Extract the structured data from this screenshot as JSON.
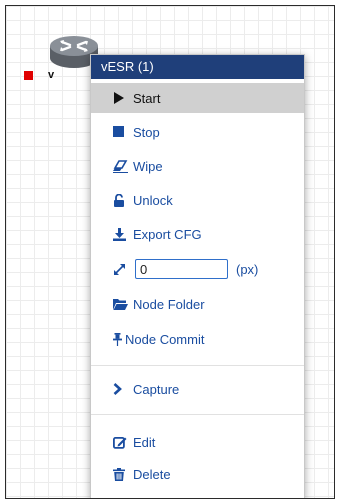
{
  "node": {
    "label_fragment": "v",
    "icon": "router-icon",
    "status_color": "#e00000"
  },
  "menu": {
    "title": "vESR (1)",
    "header_color": "#1f3f7a",
    "items": {
      "start": {
        "label": "Start",
        "icon": "play-icon"
      },
      "stop": {
        "label": "Stop",
        "icon": "stop-icon"
      },
      "wipe": {
        "label": "Wipe",
        "icon": "eraser-icon"
      },
      "unlock": {
        "label": "Unlock",
        "icon": "unlock-icon"
      },
      "export_cfg": {
        "label": "Export CFG",
        "icon": "download-icon"
      },
      "resize": {
        "value": "0",
        "unit": "(px)",
        "icon": "resize-icon"
      },
      "node_folder": {
        "label": "Node Folder",
        "icon": "folder-icon"
      },
      "node_commit": {
        "label": "Node Commit",
        "icon": "pin-icon"
      },
      "capture": {
        "label": "Capture",
        "icon": "chevron-right-icon"
      },
      "edit": {
        "label": "Edit",
        "icon": "edit-icon"
      },
      "delete": {
        "label": "Delete",
        "icon": "trash-icon"
      }
    }
  }
}
